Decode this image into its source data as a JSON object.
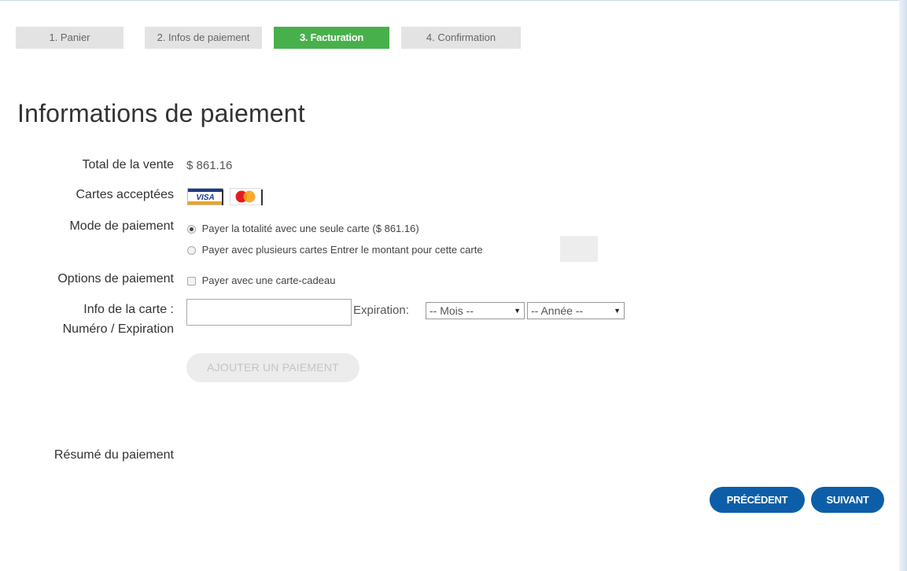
{
  "steps": [
    {
      "label": "1. Panier",
      "active": false
    },
    {
      "label": "2. Infos de paiement",
      "active": false
    },
    {
      "label": "3. Facturation",
      "active": true
    },
    {
      "label": "4. Confirmation",
      "active": false
    }
  ],
  "page_title": "Informations de paiement",
  "total": {
    "label": "Total de la vente",
    "value": "$ 861.16"
  },
  "cards": {
    "label": "Cartes acceptées",
    "icons": [
      "visa-card-icon",
      "mastercard-icon"
    ]
  },
  "payment_mode": {
    "label": "Mode de paiement",
    "option_single": "Payer la totalité avec une seule carte ($ 861.16)",
    "option_multiple": "Payer avec plusieurs cartes Entrer le montant pour cette carte",
    "selected": "single"
  },
  "payment_options": {
    "label": "Options de paiement",
    "gift_card": "Payer avec une carte-cadeau"
  },
  "card_info": {
    "label_line1": "Info de la carte :",
    "label_line2": "Numéro / Expiration",
    "expiration_label": "Expiration:",
    "month_selected": "-- Mois --",
    "year_selected": "-- Année --"
  },
  "add_payment_button": "AJOUTER UN PAIEMENT",
  "summary_label": "Résumé du paiement",
  "nav": {
    "previous": "PRÉCÉDENT",
    "next": "SUIVANT"
  },
  "colors": {
    "active_step": "#48b04b",
    "primary_button": "#0d5ea8"
  }
}
